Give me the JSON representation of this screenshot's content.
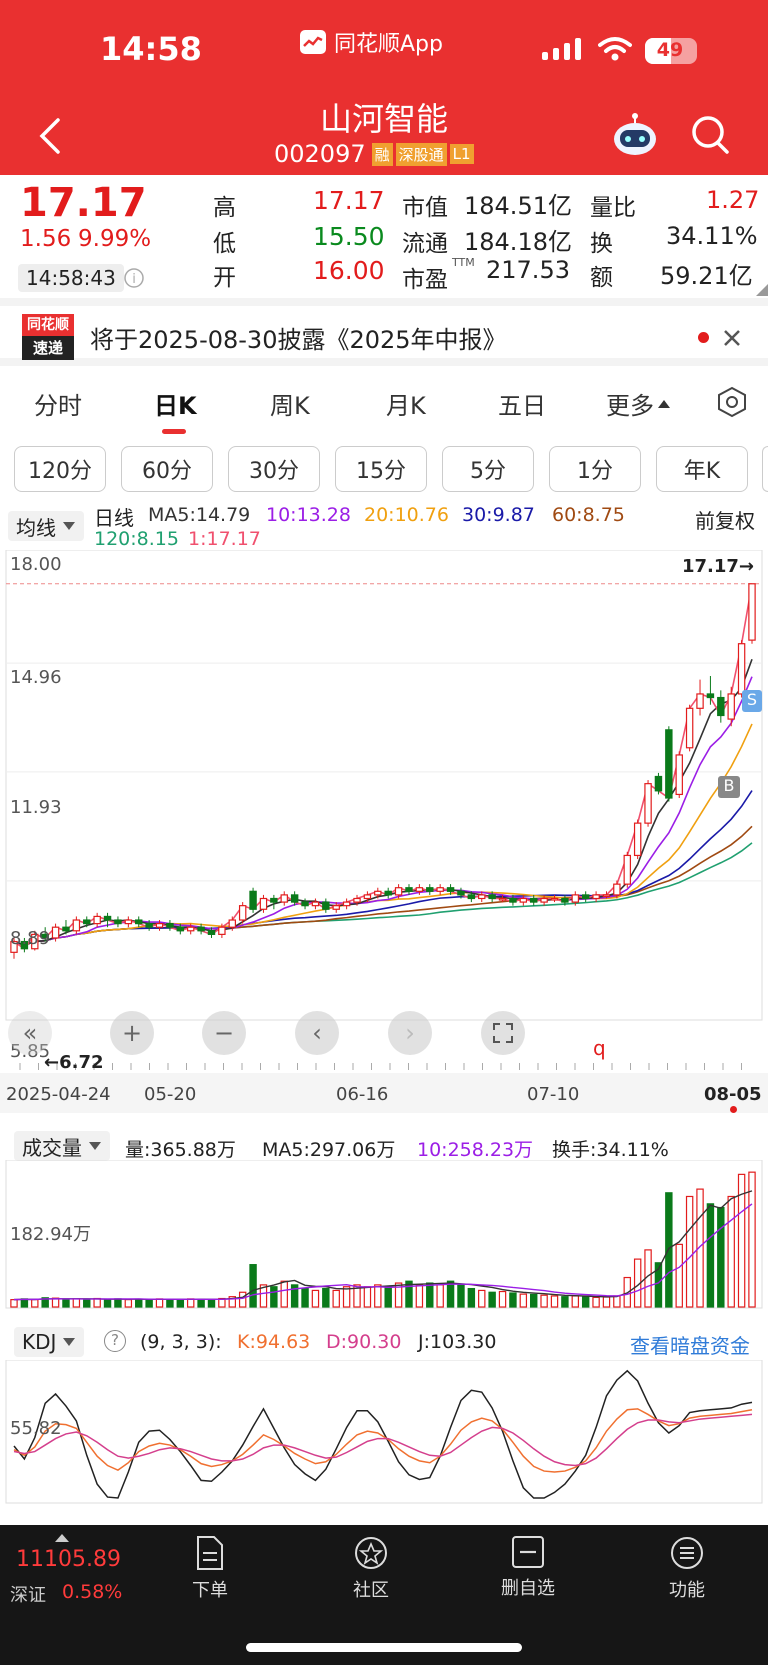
{
  "status_bar": {
    "time": "14:58",
    "app_name": "同花顺App",
    "battery": "49"
  },
  "stock": {
    "name": "山河智能",
    "code": "002097",
    "tags": [
      "融",
      "深股通",
      "L1"
    ]
  },
  "quote": {
    "price": "17.17",
    "change": "1.56",
    "change_pct": "9.99%",
    "time": "14:58:43",
    "high_label": "高",
    "high": "17.17",
    "low_label": "低",
    "low": "15.50",
    "open_label": "开",
    "open": "16.00",
    "mktcap_label": "市值",
    "mktcap": "184.51亿",
    "float_label": "流通",
    "float": "184.18亿",
    "pe_label": "市盈",
    "pe_sup": "TTM",
    "pe": "217.53",
    "vr_label": "量比",
    "vr": "1.27",
    "turnover_label": "换",
    "turnover": "34.11%",
    "amount_label": "额",
    "amount": "59.21亿"
  },
  "notice": {
    "badge_top": "同花顺",
    "badge_bottom": "速递",
    "text": "将于2025-08-30披露《2025年中报》"
  },
  "tabs": [
    "分时",
    "日K",
    "周K",
    "月K",
    "五日",
    "更多"
  ],
  "active_tab": "日K",
  "intervals": [
    "120分",
    "60分",
    "30分",
    "15分",
    "5分",
    "1分",
    "年K"
  ],
  "ma_bar": {
    "selector": "均线",
    "period": "日线",
    "ma5": "MA5:14.79",
    "ma10": "10:13.28",
    "ma20": "20:10.76",
    "ma30": "30:9.87",
    "ma60": "60:8.75",
    "ma120": "120:8.15",
    "ma1": "1:17.17",
    "adjust": "前复权"
  },
  "colors": {
    "ma5": "#333333",
    "ma10": "#9b1ee6",
    "ma20": "#f0a010",
    "ma30": "#1a1aa8",
    "ma60": "#a04a12",
    "ma120": "#20a070",
    "ma1": "#f0506e",
    "up": "#e21c1c",
    "down": "#0a7a1a"
  },
  "price_axis": [
    "18.00",
    "14.96",
    "11.93",
    "8.89",
    "5.85"
  ],
  "price_marks": {
    "latest": "17.17→",
    "low": "←6.72",
    "s_marker": "S",
    "b_marker": "B",
    "q_marker": "q"
  },
  "date_axis": [
    "2025-04-24",
    "05-20",
    "06-16",
    "07-10",
    "08-05"
  ],
  "volume": {
    "selector": "成交量",
    "vol": "量:365.88万",
    "ma5": "MA5:297.06万",
    "ma10": "10:258.23万",
    "turnover": "换手:34.11%",
    "axis_mid": "182.94万"
  },
  "kdj": {
    "selector": "KDJ",
    "help": "?",
    "params": "(9, 3, 3):",
    "k": "K:94.63",
    "d": "D:90.30",
    "j": "J:103.30",
    "link": "查看暗盘资金",
    "axis_mid": "55.82"
  },
  "index": {
    "value": "11105.89",
    "name": "深证",
    "pct": "0.58%"
  },
  "bottom_nav": [
    "下单",
    "社区",
    "删自选",
    "功能"
  ],
  "chart_data": {
    "type": "candlestick",
    "ylim": [
      5.85,
      18.0
    ],
    "candles": [
      [
        6.9,
        7.2,
        6.72,
        7.3
      ],
      [
        7.2,
        7.0,
        6.9,
        7.3
      ],
      [
        7.0,
        7.4,
        6.95,
        7.5
      ],
      [
        7.4,
        7.3,
        7.2,
        7.6
      ],
      [
        7.3,
        7.6,
        7.2,
        7.7
      ],
      [
        7.6,
        7.5,
        7.4,
        7.8
      ],
      [
        7.5,
        7.8,
        7.4,
        7.9
      ],
      [
        7.8,
        7.7,
        7.6,
        7.9
      ],
      [
        7.7,
        7.9,
        7.6,
        8.0
      ],
      [
        7.9,
        7.8,
        7.6,
        8.0
      ],
      [
        7.8,
        7.7,
        7.6,
        7.9
      ],
      [
        7.7,
        7.8,
        7.6,
        7.9
      ],
      [
        7.8,
        7.7,
        7.6,
        7.9
      ],
      [
        7.7,
        7.6,
        7.5,
        7.8
      ],
      [
        7.6,
        7.7,
        7.5,
        7.8
      ],
      [
        7.7,
        7.6,
        7.5,
        7.8
      ],
      [
        7.6,
        7.5,
        7.4,
        7.7
      ],
      [
        7.5,
        7.6,
        7.4,
        7.7
      ],
      [
        7.6,
        7.5,
        7.4,
        7.7
      ],
      [
        7.5,
        7.4,
        7.3,
        7.6
      ],
      [
        7.4,
        7.6,
        7.3,
        7.7
      ],
      [
        7.6,
        7.8,
        7.5,
        7.9
      ],
      [
        7.8,
        8.2,
        7.7,
        8.3
      ],
      [
        8.6,
        8.1,
        8.0,
        8.7
      ],
      [
        8.1,
        8.4,
        8.0,
        8.5
      ],
      [
        8.4,
        8.3,
        8.1,
        8.5
      ],
      [
        8.3,
        8.5,
        8.2,
        8.6
      ],
      [
        8.5,
        8.3,
        8.2,
        8.6
      ],
      [
        8.3,
        8.2,
        8.1,
        8.4
      ],
      [
        8.2,
        8.3,
        8.1,
        8.4
      ],
      [
        8.3,
        8.1,
        8.0,
        8.4
      ],
      [
        8.1,
        8.2,
        8.0,
        8.3
      ],
      [
        8.2,
        8.3,
        8.1,
        8.4
      ],
      [
        8.3,
        8.4,
        8.2,
        8.5
      ],
      [
        8.4,
        8.5,
        8.3,
        8.6
      ],
      [
        8.5,
        8.6,
        8.4,
        8.7
      ],
      [
        8.6,
        8.5,
        8.4,
        8.7
      ],
      [
        8.5,
        8.7,
        8.4,
        8.8
      ],
      [
        8.7,
        8.6,
        8.5,
        8.8
      ],
      [
        8.6,
        8.7,
        8.5,
        8.8
      ],
      [
        8.7,
        8.6,
        8.5,
        8.8
      ],
      [
        8.6,
        8.7,
        8.5,
        8.8
      ],
      [
        8.7,
        8.6,
        8.5,
        8.8
      ],
      [
        8.6,
        8.5,
        8.4,
        8.7
      ],
      [
        8.5,
        8.4,
        8.3,
        8.6
      ],
      [
        8.4,
        8.5,
        8.3,
        8.6
      ],
      [
        8.5,
        8.4,
        8.3,
        8.6
      ],
      [
        8.4,
        8.4,
        8.3,
        8.5
      ],
      [
        8.4,
        8.3,
        8.2,
        8.5
      ],
      [
        8.3,
        8.4,
        8.2,
        8.5
      ],
      [
        8.4,
        8.3,
        8.2,
        8.5
      ],
      [
        8.3,
        8.4,
        8.2,
        8.5
      ],
      [
        8.4,
        8.4,
        8.3,
        8.5
      ],
      [
        8.4,
        8.3,
        8.2,
        8.5
      ],
      [
        8.3,
        8.5,
        8.2,
        8.6
      ],
      [
        8.5,
        8.4,
        8.3,
        8.6
      ],
      [
        8.4,
        8.5,
        8.3,
        8.6
      ],
      [
        8.5,
        8.5,
        8.4,
        8.6
      ],
      [
        8.5,
        8.8,
        8.4,
        8.9
      ],
      [
        8.8,
        9.6,
        8.7,
        9.7
      ],
      [
        9.6,
        10.5,
        9.5,
        10.6
      ],
      [
        10.5,
        11.6,
        10.4,
        11.7
      ],
      [
        11.8,
        11.4,
        11.3,
        11.9
      ],
      [
        13.1,
        11.2,
        11.1,
        13.2
      ],
      [
        11.3,
        12.4,
        11.2,
        12.5
      ],
      [
        12.6,
        13.7,
        12.5,
        13.8
      ],
      [
        13.7,
        14.1,
        13.5,
        14.5
      ],
      [
        14.1,
        14.0,
        13.8,
        14.6
      ],
      [
        14.0,
        13.5,
        13.3,
        14.2
      ],
      [
        13.4,
        14.1,
        13.2,
        14.3
      ],
      [
        14.1,
        15.5,
        14.0,
        15.6
      ],
      [
        15.6,
        17.17,
        15.5,
        17.17
      ]
    ],
    "volume": [
      20,
      22,
      20,
      25,
      24,
      20,
      22,
      20,
      23,
      21,
      22,
      20,
      21,
      20,
      22,
      21,
      20,
      22,
      21,
      20,
      23,
      28,
      40,
      115,
      60,
      55,
      70,
      60,
      50,
      45,
      50,
      45,
      55,
      60,
      55,
      60,
      55,
      65,
      70,
      60,
      65,
      60,
      70,
      60,
      50,
      45,
      40,
      42,
      38,
      35,
      34,
      32,
      30,
      28,
      30,
      28,
      26,
      27,
      30,
      80,
      130,
      155,
      120,
      310,
      170,
      300,
      320,
      280,
      270,
      300,
      360,
      366
    ],
    "kdj_k": [
      52,
      46,
      55,
      72,
      80,
      79,
      75,
      60,
      45,
      35,
      30,
      38,
      50,
      56,
      59,
      57,
      52,
      45,
      37,
      34,
      36,
      40,
      47,
      57,
      68,
      63,
      56,
      48,
      42,
      37,
      39,
      47,
      58,
      68,
      72,
      70,
      63,
      53,
      45,
      40,
      38,
      45,
      58,
      73,
      82,
      86,
      83,
      74,
      60,
      45,
      34,
      29,
      28,
      29,
      33,
      40,
      54,
      72,
      85,
      95,
      96,
      90,
      83,
      78,
      80,
      86,
      88,
      89,
      90,
      91,
      93,
      95
    ],
    "kdj_d": [
      50,
      48,
      50,
      57,
      64,
      69,
      71,
      67,
      60,
      52,
      45,
      43,
      45,
      48,
      52,
      54,
      53,
      50,
      46,
      42,
      40,
      40,
      42,
      47,
      54,
      57,
      57,
      54,
      50,
      46,
      43,
      44,
      49,
      55,
      61,
      64,
      64,
      60,
      55,
      50,
      46,
      45,
      49,
      57,
      65,
      72,
      76,
      75,
      70,
      62,
      53,
      45,
      39,
      36,
      35,
      37,
      43,
      53,
      64,
      74,
      81,
      84,
      84,
      82,
      81,
      83,
      85,
      86,
      87,
      88,
      89,
      90
    ],
    "kdj_j": [
      56,
      42,
      65,
      102,
      112,
      99,
      83,
      46,
      15,
      1,
      0,
      28,
      60,
      72,
      73,
      63,
      50,
      35,
      19,
      18,
      28,
      40,
      57,
      77,
      96,
      75,
      54,
      36,
      26,
      19,
      31,
      53,
      76,
      94,
      94,
      82,
      61,
      39,
      25,
      20,
      22,
      45,
      76,
      105,
      116,
      114,
      97,
      72,
      40,
      11,
      0,
      0,
      6,
      15,
      29,
      46,
      76,
      110,
      127,
      137,
      126,
      102,
      81,
      70,
      78,
      92,
      94,
      95,
      96,
      97,
      101,
      103
    ]
  }
}
